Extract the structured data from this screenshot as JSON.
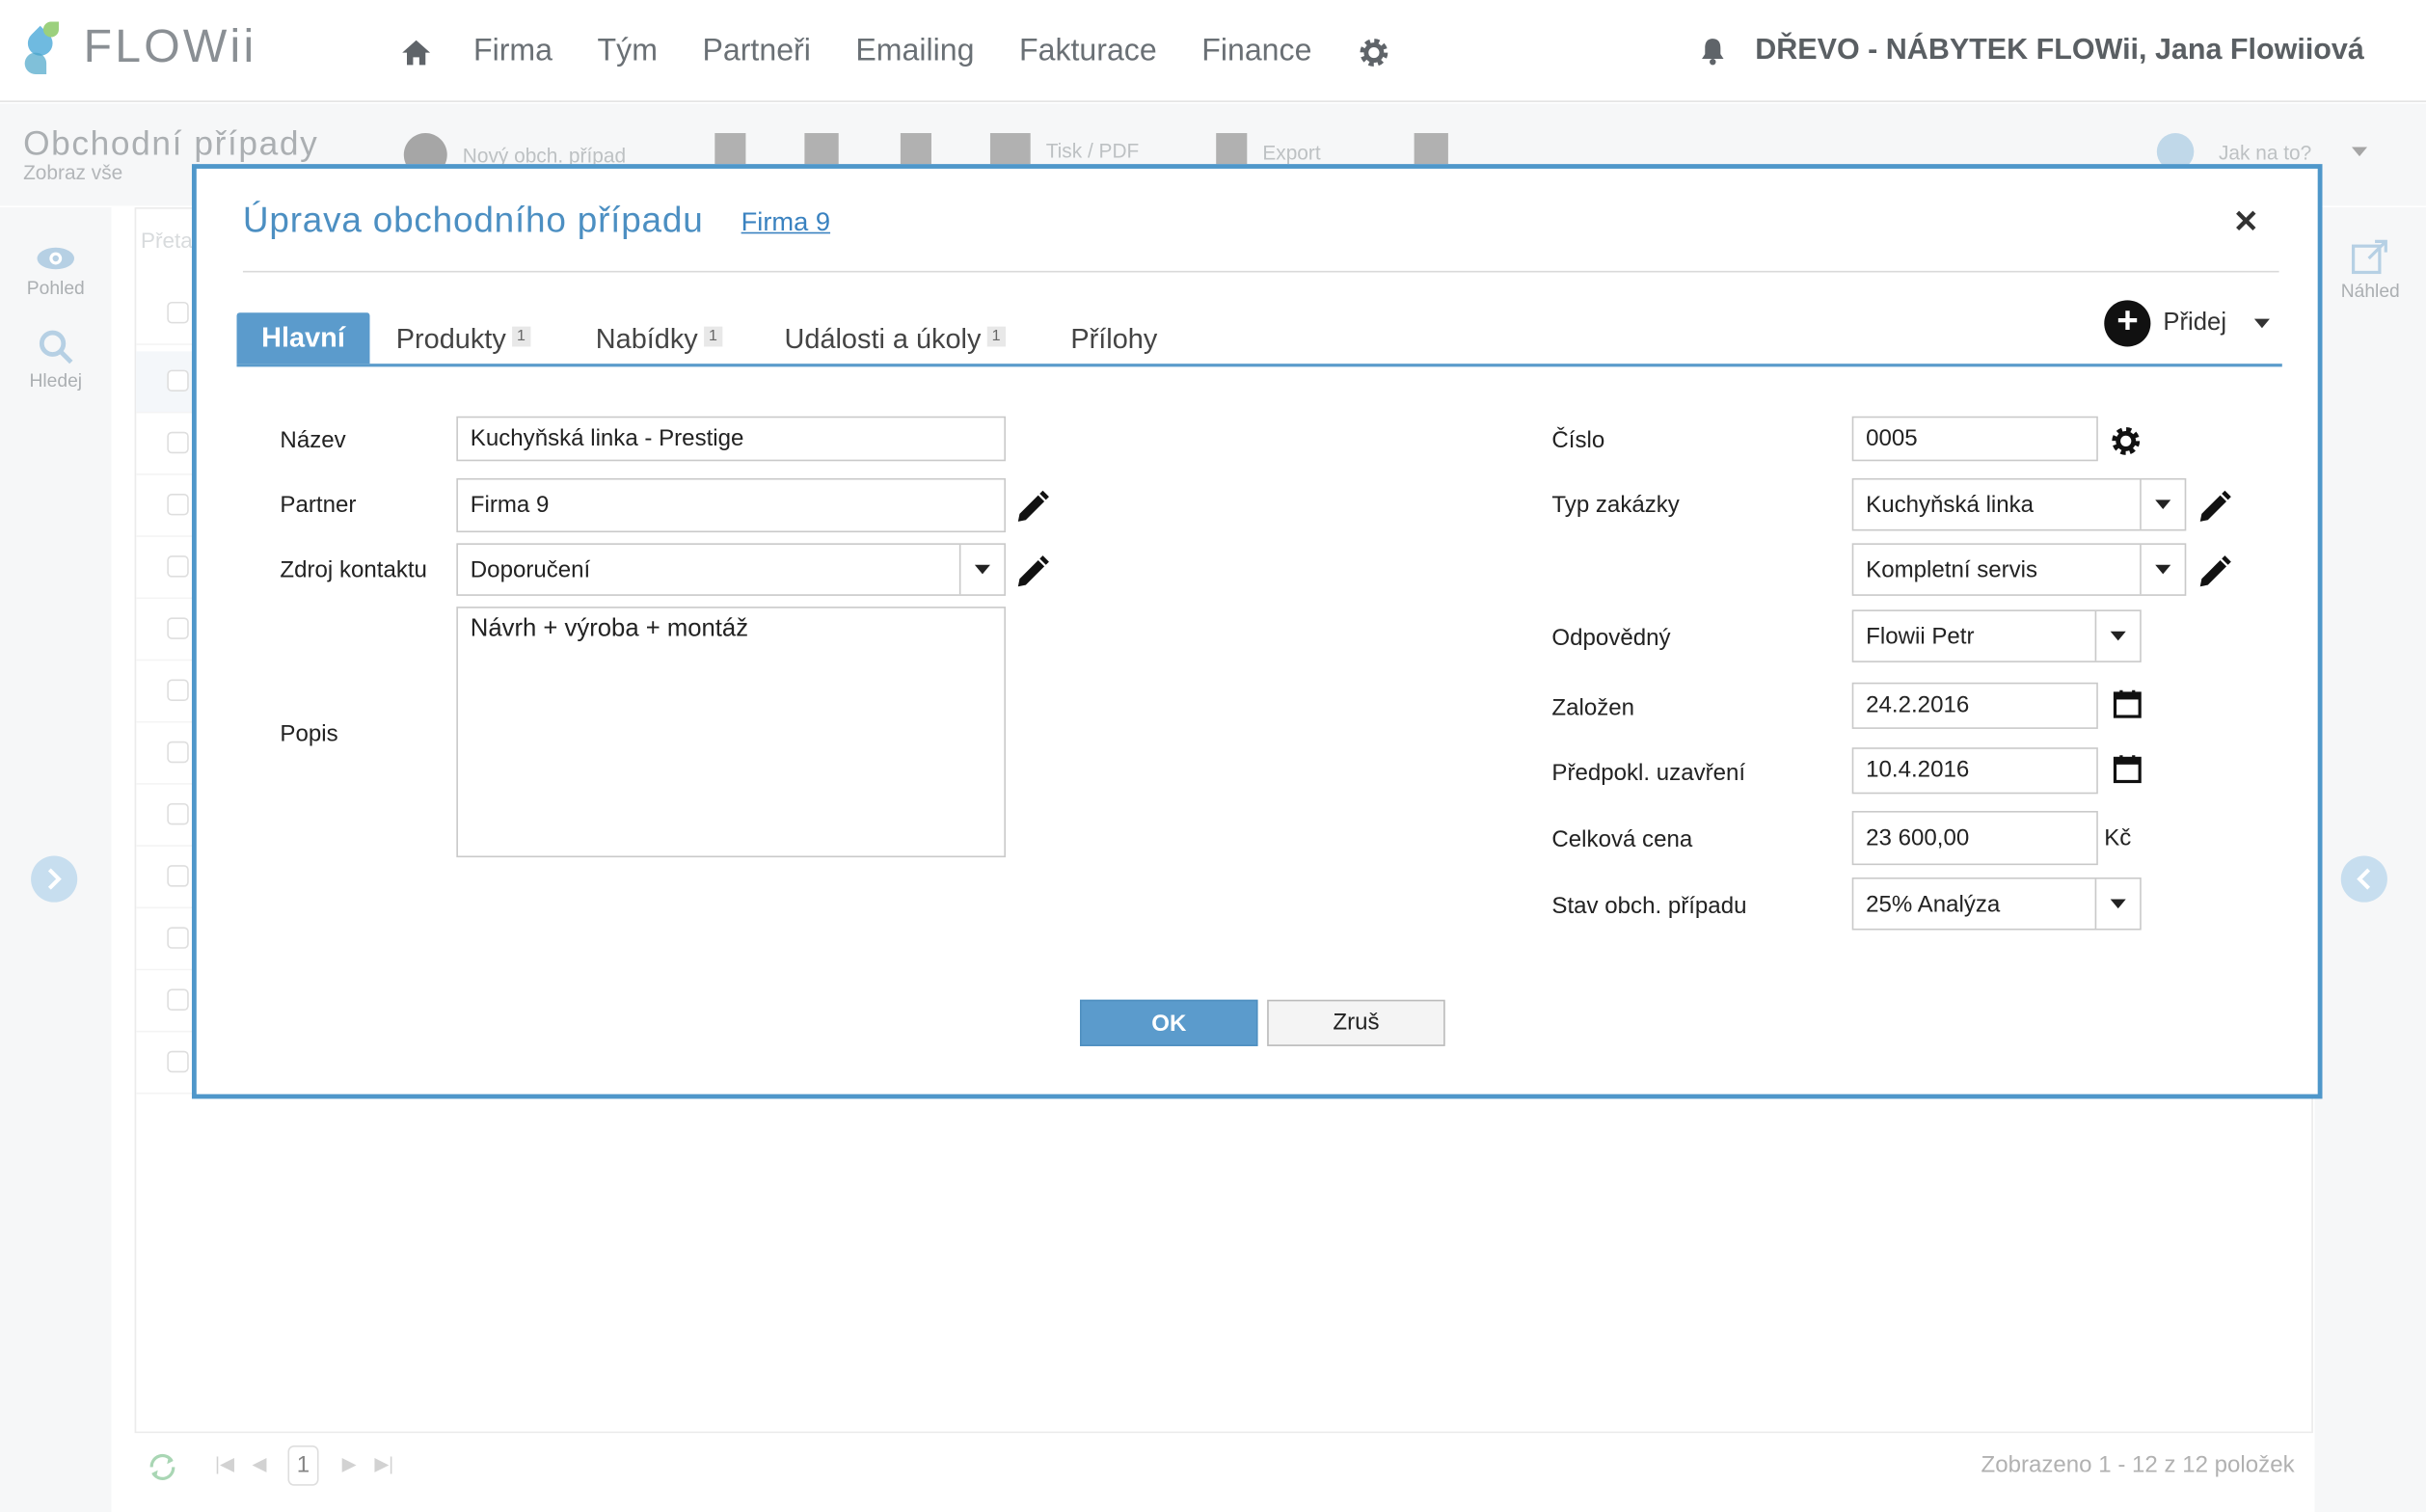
{
  "app": {
    "logo_text": "FLOWii",
    "nav": [
      "Firma",
      "Tým",
      "Partneři",
      "Emailing",
      "Fakturace",
      "Finance"
    ],
    "user": "DŘEVO - NÁBYTEK FLOWii, Jana Flowiiová"
  },
  "page": {
    "title": "Obchodní případy",
    "subtitle": "Zobraz vše",
    "toolbar": {
      "new": "Nový obch. případ",
      "print": "Tisk / PDF",
      "export": "Export",
      "help": "Jak na to?"
    },
    "left": {
      "view": "Pohled",
      "search": "Hledej"
    },
    "right": {
      "preview": "Náhled"
    },
    "search_placeholder": "Přeta",
    "pager": {
      "page": "1",
      "summary": "Zobrazeno 1 - 12 z 12 položek"
    }
  },
  "modal": {
    "title": "Úprava obchodního případu",
    "company_link": "Firma 9",
    "tabs": [
      {
        "label": "Hlavní"
      },
      {
        "label": "Produkty",
        "badge": "1"
      },
      {
        "label": "Nabídky",
        "badge": "1"
      },
      {
        "label": "Události a úkoly",
        "badge": "1"
      },
      {
        "label": "Přílohy"
      }
    ],
    "add_label": "Přidej",
    "fields": {
      "name_label": "Název",
      "name_value": "Kuchyňská linka - Prestige",
      "partner_label": "Partner",
      "partner_value": "Firma 9",
      "source_label": "Zdroj kontaktu",
      "source_value": "Doporučení",
      "desc_label": "Popis",
      "desc_value": "Návrh + výroba + montáž",
      "number_label": "Číslo",
      "number_value": "0005",
      "order_type_label": "Typ zakázky",
      "order_type_value": "Kuchyňská linka",
      "order_type2_value": "Kompletní servis",
      "responsible_label": "Odpovědný",
      "responsible_value": "Flowii Petr",
      "created_label": "Založen",
      "created_value": "24.2.2016",
      "close_label": "Předpokl. uzavření",
      "close_value": "10.4.2016",
      "price_label": "Celková cena",
      "price_value": "23 600,00",
      "currency": "Kč",
      "state_label": "Stav obch. případu",
      "state_value": "25% Analýza"
    },
    "ok": "OK",
    "cancel": "Zruš"
  },
  "colors": {
    "accent": "#5b9bcc",
    "title": "#4c8fc2"
  },
  "icons": [
    "home-icon",
    "gear-icon",
    "bell-icon",
    "pencil-icon",
    "calendar-icon",
    "close-icon",
    "plus-icon",
    "eye-icon",
    "search-icon",
    "external-link-icon"
  ]
}
